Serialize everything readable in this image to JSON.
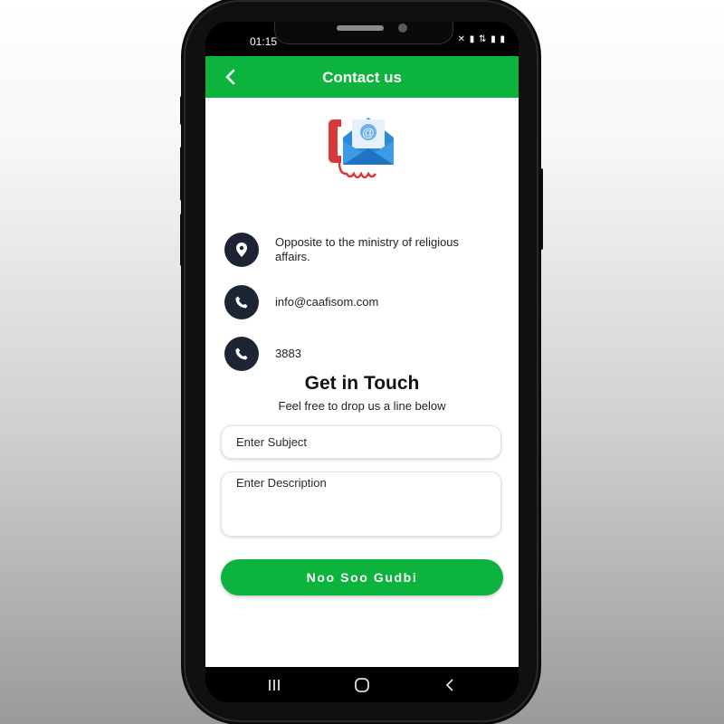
{
  "status_bar": {
    "time": "01:15",
    "icons": "✕ ▮ ⇅ ▮ ▮"
  },
  "header": {
    "title": "Contact us",
    "back_icon": "chevron-left-icon"
  },
  "hero_icon": "contact-envelope-phone-icon",
  "contact_items": [
    {
      "icon": "location-pin-icon",
      "text": "Opposite to the ministry of religious affairs."
    },
    {
      "icon": "phone-icon",
      "text": "info@caafisom.com"
    },
    {
      "icon": "phone-icon",
      "text": "3883"
    }
  ],
  "get_in_touch": {
    "title": "Get in Touch",
    "subtitle": "Feel free to drop us a line below"
  },
  "form": {
    "subject_placeholder": "Enter Subject",
    "description_placeholder": "Enter Description",
    "submit_label": "Noo Soo Gudbi"
  },
  "nav_bar": {
    "recents_icon": "recents-icon",
    "home_icon": "home-icon",
    "back_icon": "back-icon"
  },
  "colors": {
    "primary": "#0cb33c",
    "icon_circle": "#1d2433"
  }
}
